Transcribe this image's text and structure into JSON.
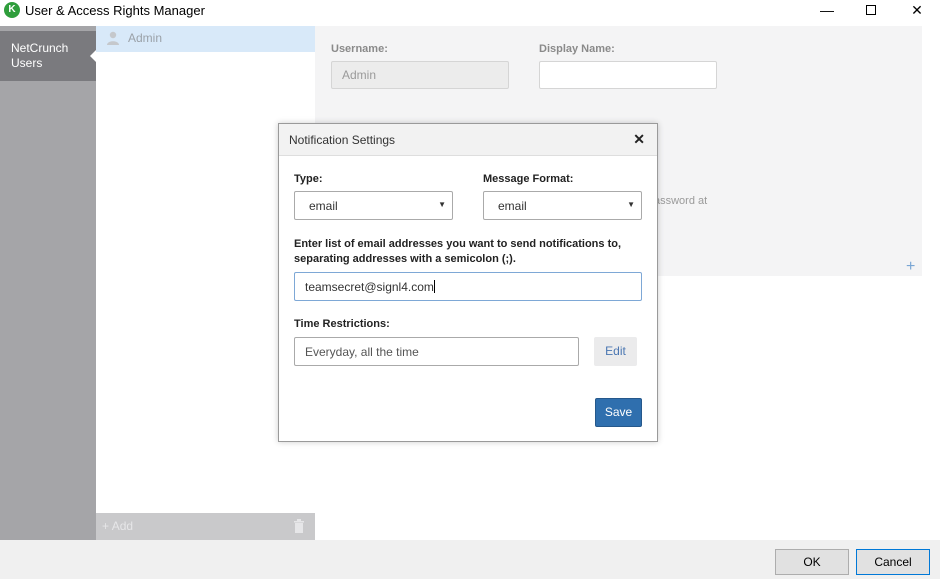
{
  "window": {
    "title": "User & Access Rights Manager",
    "logo_letter": "K"
  },
  "nav": {
    "users_label_line1": "NetCrunch",
    "users_label_line2": "Users"
  },
  "userlist": {
    "items": [
      {
        "name": "Admin"
      }
    ],
    "add_label": "Add"
  },
  "form": {
    "username_label": "Username:",
    "username_value": "Admin",
    "display_name_label": "Display Name:",
    "display_name_value": "",
    "partial_note": "assword at"
  },
  "dialog": {
    "title": "Notification Settings",
    "type_label": "Type:",
    "type_value": "email",
    "format_label": "Message Format:",
    "format_value": "email",
    "instructions": "Enter list of email addresses you want to send notifications to, separating addresses with a semicolon (;).",
    "email_value": "teamsecret@signl4.com",
    "time_label": "Time Restrictions:",
    "time_value": "Everyday, all the time",
    "edit_label": "Edit",
    "save_label": "Save"
  },
  "footer": {
    "ok_label": "OK",
    "cancel_label": "Cancel"
  },
  "colors": {
    "accent": "#2f6fae",
    "nav_bg": "#a5a5a8",
    "nav_active": "#7a7a7e",
    "selected_row": "#d8e9f9"
  }
}
